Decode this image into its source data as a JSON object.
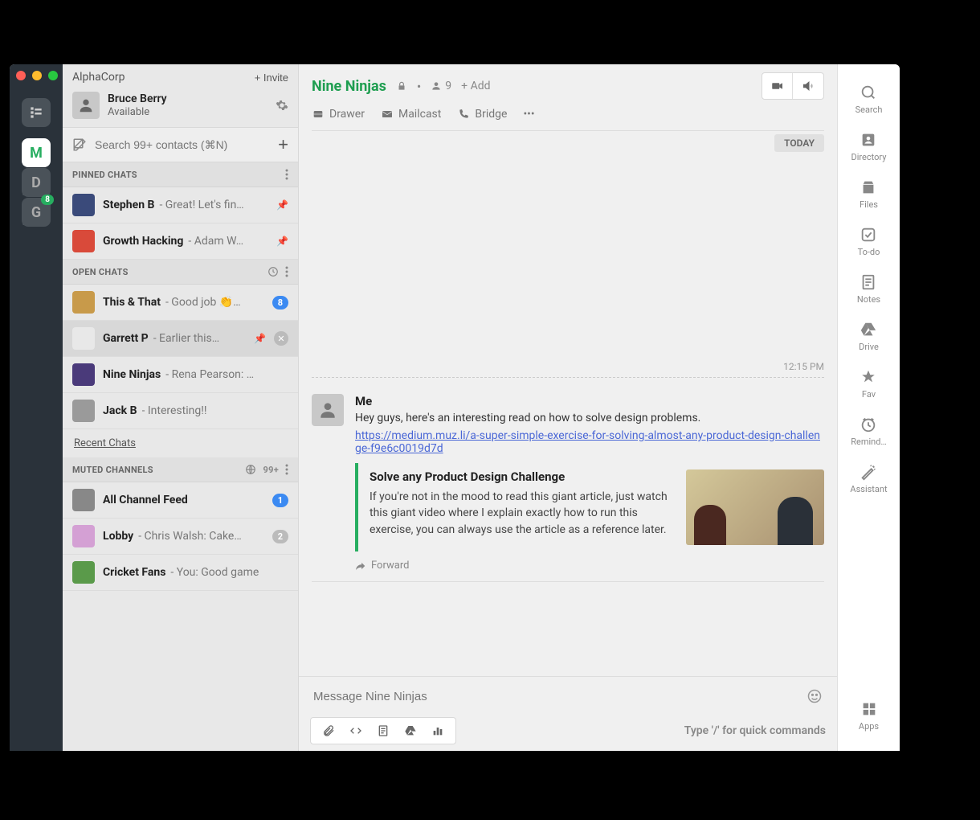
{
  "workspace": {
    "items": [
      {
        "letter": "M",
        "bg": "#fff",
        "color": "#27ae60",
        "shortcut": "⌘1"
      },
      {
        "letter": "D",
        "bg": "#4a5259",
        "color": "#aaa",
        "shortcut": "⌘2"
      },
      {
        "letter": "G",
        "bg": "#4a5259",
        "color": "#aaa",
        "shortcut": "⌘3",
        "badge": "8"
      }
    ]
  },
  "sidebar": {
    "org_name": "AlphaCorp",
    "invite": "+ Invite",
    "profile": {
      "name": "Bruce Berry",
      "status": "Available"
    },
    "search_placeholder": "Search 99+ contacts (⌘N)",
    "sections": {
      "pinned": {
        "title": "PINNED CHATS",
        "items": [
          {
            "name": "Stephen B",
            "preview": "- Great! Let's fin…",
            "avatar_bg": "#3a4a7a"
          },
          {
            "name": "Growth Hacking",
            "preview": "- Adam W…",
            "avatar_bg": "#d94a3a"
          }
        ]
      },
      "open": {
        "title": "OPEN CHATS",
        "items": [
          {
            "name": "This & That",
            "preview": "- Good job 👏…",
            "badge": "8",
            "avatar_bg": "#c89a4a"
          },
          {
            "name": "Garrett P",
            "preview": "- Earlier this…",
            "avatar_bg": "#e8e8e8",
            "selected": true,
            "pin": true,
            "close": true
          },
          {
            "name": "Nine Ninjas",
            "preview": "- Rena Pearson: …",
            "avatar_bg": "#4a3a7a"
          },
          {
            "name": "Jack B",
            "preview": "- Interesting!!",
            "avatar_bg": "#9a9a9a"
          }
        ]
      },
      "recent_label": "Recent Chats",
      "muted": {
        "title": "MUTED CHANNELS",
        "count": "99+",
        "items": [
          {
            "name": "All Channel Feed",
            "preview": "",
            "badge_blue": "1",
            "avatar_bg": "#888"
          },
          {
            "name": "Lobby",
            "preview": "- Chris Walsh: Cake…",
            "badge_grey": "2",
            "avatar_bg": "#d4a0d4"
          },
          {
            "name": "Cricket Fans",
            "preview": "- You: Good game",
            "avatar_bg": "#5a9a4a"
          }
        ]
      }
    }
  },
  "channel": {
    "name": "Nine Ninjas",
    "member_count": "9",
    "add_label": "+ Add",
    "tabs": [
      {
        "label": "Drawer"
      },
      {
        "label": "Mailcast"
      },
      {
        "label": "Bridge"
      }
    ],
    "date_label": "TODAY",
    "timestamp": "12:15 PM"
  },
  "message": {
    "author": "Me",
    "text": "Hey guys, here's an interesting read on how to solve design problems.",
    "link": "https://medium.muz.li/a-super-simple-exercise-for-solving-almost-any-product-design-challenge-f9e6c0019d7d",
    "card": {
      "title": "Solve any Product Design Challenge",
      "desc": "If you're not in the mood to read this giant article, just watch this giant video where I explain exactly how to run this exercise, you can always use the article as a reference later."
    },
    "forward": "Forward"
  },
  "composer": {
    "placeholder": "Message Nine Ninjas",
    "hint": "Type '/' for quick commands"
  },
  "rail": {
    "items": [
      {
        "label": "Search",
        "icon": "search"
      },
      {
        "label": "Directory",
        "icon": "directory"
      },
      {
        "label": "Files",
        "icon": "files"
      },
      {
        "label": "To-do",
        "icon": "todo"
      },
      {
        "label": "Notes",
        "icon": "notes"
      },
      {
        "label": "Drive",
        "icon": "drive"
      },
      {
        "label": "Fav",
        "icon": "star"
      },
      {
        "label": "Remind…",
        "icon": "clock"
      },
      {
        "label": "Assistant",
        "icon": "wand"
      }
    ],
    "apps_label": "Apps"
  }
}
